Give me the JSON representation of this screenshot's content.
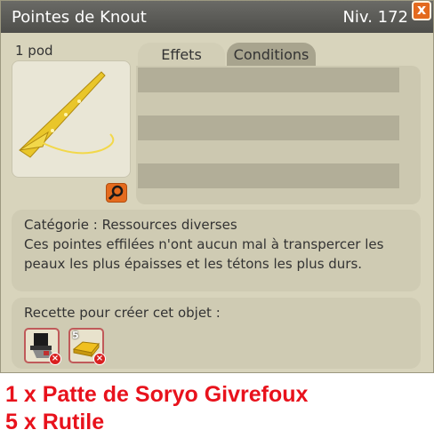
{
  "window": {
    "title": "Pointes de Knout",
    "level": "Niv. 172",
    "close_label": "x"
  },
  "item": {
    "weight": "1 pod",
    "icon": "golden-spike-icon"
  },
  "tabs": [
    {
      "label": "Effets",
      "active": true
    },
    {
      "label": "Conditions",
      "active": false
    }
  ],
  "description": {
    "category": "Catégorie : Ressources diverses",
    "text": "Ces pointes effilées n'ont aucun mal à transpercer les peaux les plus épaisses et les tétons les plus durs."
  },
  "recipe": {
    "label": "Recette pour créer cet objet :",
    "ingredients": [
      {
        "icon": "black-hat-paw-icon",
        "quantity": ""
      },
      {
        "icon": "gold-ingot-icon",
        "quantity": "5"
      }
    ]
  },
  "caption": {
    "line1": "1 x Patte de Soryo Givrefoux",
    "line2": "5 x Rutile"
  },
  "colors": {
    "panel": "#d8d4bc",
    "titlebar": "#555551",
    "accent_orange": "#e36a1e",
    "caption_red": "#e8121c"
  }
}
